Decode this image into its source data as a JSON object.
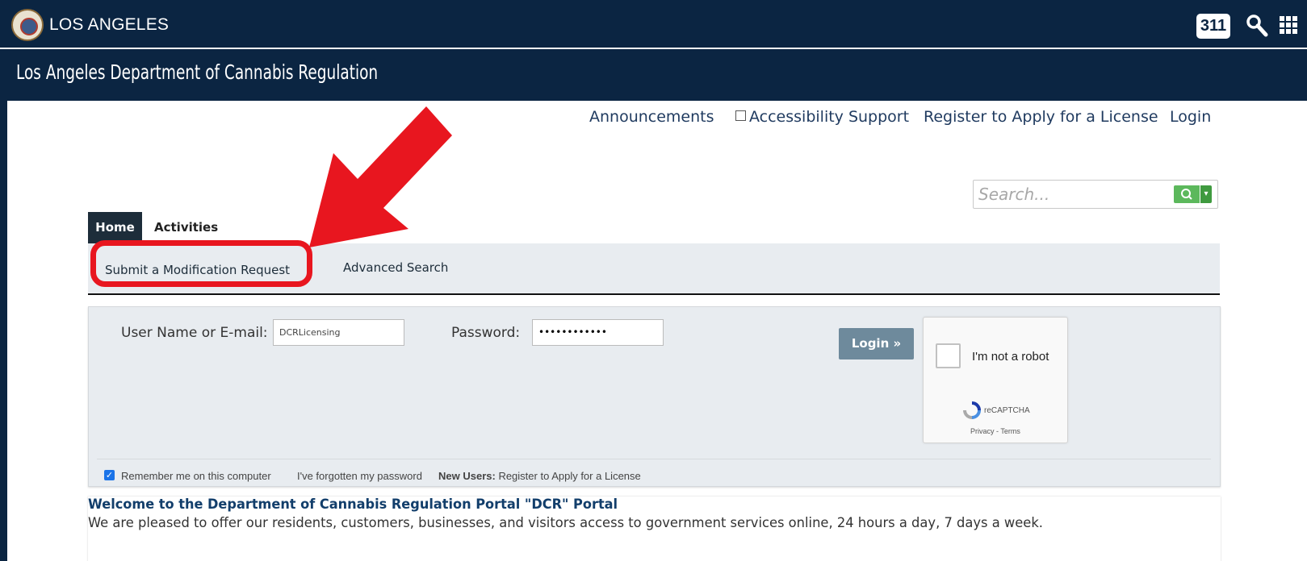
{
  "city_header": {
    "city_name": "LOS ANGELES",
    "badge_311": "311",
    "colors": {
      "background": "#0b2542",
      "text": "#ffffff"
    }
  },
  "department": {
    "title": "Los Angeles Department of Cannabis Regulation"
  },
  "top_links": {
    "announcements": "Announcements",
    "accessibility": "Accessibility Support",
    "register": "Register to Apply for a License",
    "login": "Login"
  },
  "search": {
    "placeholder": "Search...",
    "button_icon": "search-icon",
    "dropdown_icon": "caret-down-icon",
    "accent": "#5cb85c"
  },
  "tabs": {
    "home": "Home",
    "activities": "Activities"
  },
  "subnav": {
    "modification": "Submit a Modification Request",
    "advanced_search": "Advanced Search"
  },
  "login_form": {
    "username_label": "User Name or E-mail:",
    "username_value": "DCRLicensing",
    "password_label": "Password:",
    "password_value": "••••••••••••",
    "login_button": "Login »",
    "remember_label": "Remember me on this computer",
    "remember_checked": true,
    "forgot_link": "I've forgotten my password",
    "new_users_label": "New Users:",
    "new_users_link": "Register to Apply for a License"
  },
  "captcha": {
    "label": "I'm not a robot",
    "brand": "reCAPTCHA",
    "privacy": "Privacy",
    "separator": " - ",
    "terms": "Terms"
  },
  "welcome": {
    "title": "Welcome to the Department of Cannabis Regulation Portal \"DCR\" Portal",
    "body": "We are pleased to offer our residents, customers, businesses, and visitors access to government services online, 24 hours a day, 7 days a week."
  },
  "annotation": {
    "highlight_color": "#e8161f"
  }
}
